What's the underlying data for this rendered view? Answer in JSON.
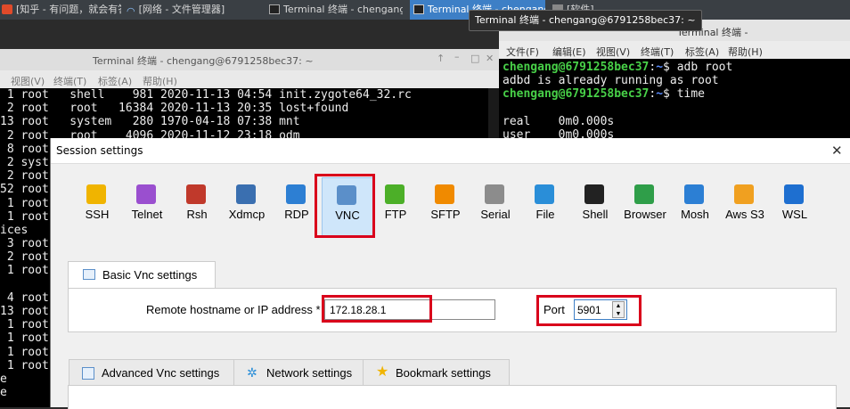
{
  "taskbar": {
    "items": [
      {
        "label": "[知乎 - 有问题，就会有答…"
      },
      {
        "label": "[网络 - 文件管理器]"
      },
      {
        "label": "Terminal 终端 - chengang…"
      },
      {
        "label": "Terminal 终端 - chengang"
      },
      {
        "label": "[软件]"
      }
    ]
  },
  "tooltip": "Terminal 终端 - chengang@6791258bec37: ~",
  "left_terminal": {
    "title": "Terminal 终端 - chengang@6791258bec37: ~",
    "menu": [
      "视图(V)",
      "终端(T)",
      "标签(A)",
      "帮助(H)"
    ],
    "lines": [
      " 1 root   shell    981 2020-11-13 04:54 init.zygote64_32.rc",
      " 2 root   root   16384 2020-11-13 20:35 lost+found",
      "13 root   system   280 1970-04-18 07:38 mnt",
      " 2 root   root    4096 2020-11-12 23:18 odm",
      " 8 root",
      " 2 syst",
      " 2 root",
      "52 root",
      " 1 root",
      " 1 root",
      "ices",
      " 3 root",
      " 2 root",
      " 1 root",
      "",
      " 4 root",
      "13 root",
      " 1 root",
      " 1 root",
      " 1 root",
      " 1 root",
      "e",
      "e"
    ]
  },
  "right_terminal": {
    "title": "Terminal 终端 - chengang@6791258bec37: ~",
    "menu": [
      "文件(F)",
      "编辑(E)",
      "视图(V)",
      "终端(T)",
      "标签(A)",
      "帮助(H)"
    ],
    "prompt_user": "chengang@6791258bec37",
    "prompt_path": "~",
    "cmd1": "adb root",
    "out1": "adbd is already running as root",
    "cmd2": "time",
    "real_label": "real",
    "real_value": "0m0.000s",
    "user_label": "user",
    "user_value": "0m0.000s"
  },
  "dialog": {
    "title": "Session settings",
    "close": "✕",
    "types": [
      {
        "label": "SSH",
        "color": "#f0b400"
      },
      {
        "label": "Telnet",
        "color": "#9a4fcf"
      },
      {
        "label": "Rsh",
        "color": "#c0392b"
      },
      {
        "label": "Xdmcp",
        "color": "#3a6fb0"
      },
      {
        "label": "RDP",
        "color": "#2d7fd3"
      },
      {
        "label": "VNC",
        "color": "#5b8fc9"
      },
      {
        "label": "FTP",
        "color": "#4caf28"
      },
      {
        "label": "SFTP",
        "color": "#f08a00"
      },
      {
        "label": "Serial",
        "color": "#8c8c8c"
      },
      {
        "label": "File",
        "color": "#2a8ed8"
      },
      {
        "label": "Shell",
        "color": "#222222"
      },
      {
        "label": "Browser",
        "color": "#2f9e49"
      },
      {
        "label": "Mosh",
        "color": "#2c7fd4"
      },
      {
        "label": "Aws S3",
        "color": "#f0a020"
      },
      {
        "label": "WSL",
        "color": "#1e6fd0"
      }
    ],
    "selected_type": "VNC",
    "basic_tab": "Basic Vnc settings",
    "host_label": "Remote hostname or IP address *",
    "host_value": "172.18.28.1",
    "port_label": "Port",
    "port_value": "5901",
    "tabs": [
      "Advanced Vnc settings",
      "Network settings",
      "Bookmark settings"
    ]
  }
}
